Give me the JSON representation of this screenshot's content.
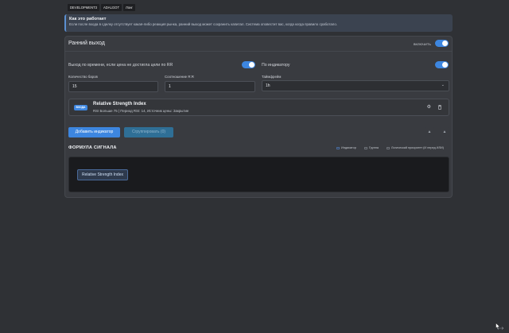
{
  "tabs": [
    "DEVELOPMENT3",
    "ADALGOT",
    "Лонг"
  ],
  "info": {
    "title": "Как это работает",
    "text": "Если после входа в сделку отсутствует какая-либо реакция рынка, ранний выход может сохранить капитал. Система оповестит вас, когда когда правило сработало."
  },
  "panel": {
    "title": "Ранний выход",
    "enable_label": "ВКЛЮЧИТЬ",
    "enable_on": true
  },
  "time_exit": {
    "label": "Выход по времени, если цена не достигла цели по RR",
    "on": true
  },
  "by_indicator": {
    "label": "По индикатору",
    "on": true
  },
  "bars": {
    "label": "Количество баров",
    "value": "15"
  },
  "rr": {
    "label": "Соотношение R:R",
    "value": "1"
  },
  "timeframe": {
    "label": "Таймфрейм",
    "value": "1h"
  },
  "indicator": {
    "badge": "ВХОДА",
    "name": "Relative Strength Index",
    "description": "RSI Больше 75 | Период RSI: 14, Источник цены: Закрытие"
  },
  "buttons": {
    "add": "Добавить индикатор",
    "group": "Сгруппировать (0)"
  },
  "formula": {
    "title": "ФОРМУЛА СИГНАЛА",
    "legend": [
      {
        "label": "Индикатор",
        "color": "#4a6a99"
      },
      {
        "label": "Группа",
        "color": "#6b6f76"
      },
      {
        "label": "Логический приоритет (И перед ИЛИ)",
        "color": "#6b6f76"
      }
    ],
    "chip": "Relative Strength Index"
  }
}
